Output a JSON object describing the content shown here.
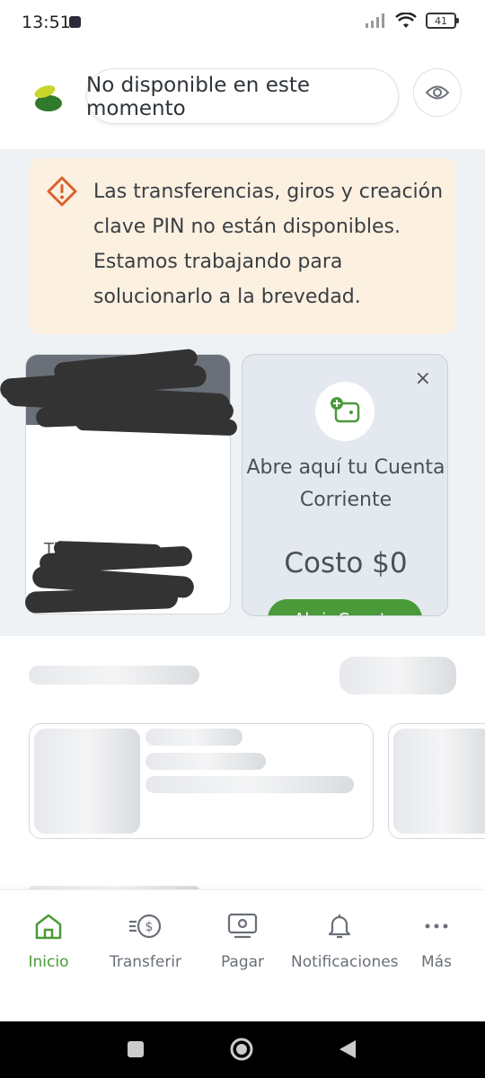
{
  "status_bar": {
    "time": "13:51",
    "battery": "41"
  },
  "header": {
    "search_text": "No disponible en este momento",
    "icons": {
      "logo": "bank-logo",
      "visibility": "eye-icon"
    }
  },
  "alert": {
    "message": "Las transferencias, giros y creación clave PIN no están disponibles. Estamos trabajando para solucionarlo a la brevedad.",
    "icon": "warning-icon",
    "colors": {
      "background": "#fcf0e0",
      "icon": "#d9622b"
    }
  },
  "account_card": {
    "partial_text": "Ti                   ta"
  },
  "promo_card": {
    "title": "Abre aquí tu Cuenta Corriente",
    "cost": "Costo $0",
    "button_label": "Abrir Cuenta",
    "close_icon": "×",
    "icon": "wallet-add-icon"
  },
  "bottom_nav": {
    "items": [
      {
        "label": "Inicio",
        "icon": "home-icon",
        "active": true
      },
      {
        "label": "Transferir",
        "icon": "transfer-icon",
        "active": false
      },
      {
        "label": "Pagar",
        "icon": "pay-icon",
        "active": false
      },
      {
        "label": "Notificaciones",
        "icon": "bell-icon",
        "active": false
      },
      {
        "label": "Más",
        "icon": "more-icon",
        "active": false
      }
    ]
  },
  "colors": {
    "accent": "#4a9a3a",
    "content_bg": "#eef2f5"
  }
}
